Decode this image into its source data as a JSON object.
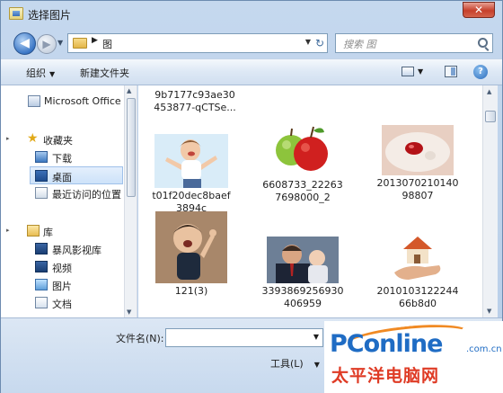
{
  "window": {
    "title": "选择图片",
    "close_symbol": "✕"
  },
  "nav": {
    "back_symbol": "◀",
    "forward_symbol": "▶",
    "history_symbol": "▼",
    "address_separator": "▶",
    "address_crumb": "图",
    "address_dropdown": "▼",
    "refresh_symbol": "↻",
    "search_placeholder": "搜索 图"
  },
  "toolbar": {
    "organize_label": "组织",
    "organize_caret": "▼",
    "new_folder_label": "新建文件夹",
    "view_caret": "▼",
    "help_symbol": "?"
  },
  "navpane": {
    "items": [
      {
        "label": "Microsoft Office",
        "icon": "office-icon"
      },
      {
        "label": "收藏夹",
        "icon": "star-icon"
      },
      {
        "label": "下载",
        "icon": "download-folder-icon"
      },
      {
        "label": "桌面",
        "icon": "desktop-icon"
      },
      {
        "label": "最近访问的位置",
        "icon": "recent-places-icon"
      },
      {
        "label": "库",
        "icon": "library-icon"
      },
      {
        "label": "暴风影视库",
        "icon": "video-library-icon"
      },
      {
        "label": "视频",
        "icon": "video-icon"
      },
      {
        "label": "图片",
        "icon": "pictures-icon"
      },
      {
        "label": "文档",
        "icon": "documents-icon"
      }
    ],
    "expander_symbol": "▸",
    "star_symbol": "★"
  },
  "files": [
    {
      "name_line1": "9b7177c93ae30",
      "name_line2": "453877-qCTSe...",
      "thumb": "none"
    },
    {
      "name_line1": "t01f20dec8baef",
      "name_line2": "3894c",
      "thumb": "happy-child"
    },
    {
      "name_line1": "6608733_22263",
      "name_line2": "7698000_2",
      "thumb": "apples"
    },
    {
      "name_line1": "2013070210140",
      "name_line2": "98807",
      "thumb": "red-bean-dish"
    },
    {
      "name_line1": "121(3)",
      "name_line2": "",
      "thumb": "baby"
    },
    {
      "name_line1": "3393869256930",
      "name_line2": "406959",
      "thumb": "man-with-baby"
    },
    {
      "name_line1": "2010103122244",
      "name_line2": "66b8d0",
      "thumb": "house-in-hand"
    }
  ],
  "bottom": {
    "filename_label": "文件名(N):",
    "filename_value": "",
    "filename_caret": "▼",
    "tools_label": "工具(L)",
    "tools_caret": "▼"
  },
  "scrollbar": {
    "up": "▲",
    "down": "▼"
  },
  "watermark": {
    "brand": "PConline",
    "domain": ".com.cn",
    "subtitle": "太平洋电脑网"
  }
}
